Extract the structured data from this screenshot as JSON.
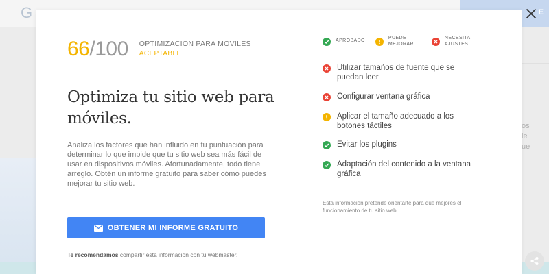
{
  "background": {
    "logo_letter": "G",
    "header_button_label": "E",
    "side_text_1": "os",
    "side_text_2": "le",
    "side_text_3": "ue"
  },
  "modal": {
    "score": {
      "value": "66",
      "separator_total": "/100",
      "title": "OPTIMIZACION PARA MOVILES",
      "rating": "ACEPTABLE"
    },
    "heading": "Optimiza tu sitio web para móviles.",
    "description": "Analiza los factores que han influido en tu puntuación para determinar lo que impide que tu sitio web sea más fácil de usar en dispositivos móviles. Afortunadamente, todo tiene arreglo. Obtén un informe gratuito para saber cómo puedes mejorar tu sitio web.",
    "cta_label": "OBTENER MI INFORME GRATUITO",
    "recommend_bold": "Te recomendamos",
    "recommend_rest": " compartir esta información con tu webmaster.",
    "legend": {
      "approved": "APROBADO",
      "improve_line1": "PUEDE",
      "improve_line2": "MEJORAR",
      "needs_line1": "NECESITA",
      "needs_line2": "AJUSTES"
    },
    "checklist": [
      {
        "status": "needs",
        "label": "Utilizar tamaños de fuente que se puedan leer"
      },
      {
        "status": "needs",
        "label": "Configurar ventana gráfica"
      },
      {
        "status": "improve",
        "label": "Aplicar el tamaño adecuado a los botones táctiles"
      },
      {
        "status": "approved",
        "label": "Evitar los plugins"
      },
      {
        "status": "approved",
        "label": "Adaptación del contenido a la ventana gráfica"
      }
    ],
    "footnote": "Esta información pretende orientarte para que mejores el funcionamiento de tu sitio web."
  },
  "colors": {
    "approved": "#34a853",
    "improve": "#f4b400",
    "needs": "#ea4335",
    "accent": "#4285f4"
  },
  "icons": {
    "close": "close-icon",
    "mail": "mail-icon",
    "share": "share-icon",
    "approved": "check-icon",
    "improve": "exclamation-icon",
    "needs": "cross-icon"
  }
}
